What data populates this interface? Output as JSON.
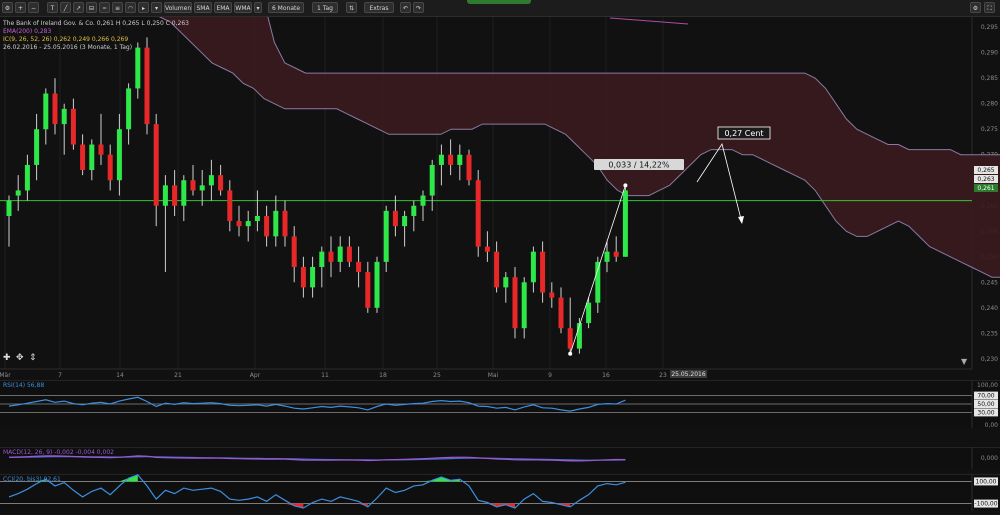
{
  "toolbar": {
    "buttons": [
      {
        "label": "Volumen",
        "name": "volume-button"
      },
      {
        "label": "SMA",
        "name": "sma-button"
      },
      {
        "label": "EMA",
        "name": "ema-button"
      },
      {
        "label": "WMA",
        "name": "wma-button"
      },
      {
        "label": "6 Monate",
        "name": "period-select"
      },
      {
        "label": "1 Tag",
        "name": "interval-select"
      },
      {
        "label": "Extras",
        "name": "extras-button"
      }
    ]
  },
  "legend": {
    "line1": "The Bank of Ireland Gov. & Co.  0,261  H  0,265  L  0,250  C  0,263",
    "line2": "EMA(200)  0,283",
    "line3": "IC(9, 26, 52, 26)  0,262  0,249  0,266  0,269",
    "line4": "26.02.2016 - 25.05.2016 (3 Monate, 1 Tag)"
  },
  "annotations": {
    "measure": "0,033 / 14,22%",
    "cent": "0,27 Cent",
    "date_badge": "25.05.2016"
  },
  "price_tags": {
    "a": "0,265",
    "b": "0,263",
    "c": "0,261"
  },
  "indicators": {
    "rsi": {
      "label": "RSI(14)  56,88",
      "color": "#3d8fe0",
      "levels": [
        "70,00",
        "50,00",
        "30,00"
      ],
      "axis": "100,00",
      "zero": "0,00"
    },
    "macd": {
      "label": "MACD(12, 26, 9)  -0,002  -0,004  0,002",
      "color": "#9b59d0",
      "axis": "0,000"
    },
    "cci": {
      "label": "CCI(20, bis3)  92,61",
      "color": "#3d8fe0",
      "levels": [
        "100,00",
        "-100,00"
      ]
    }
  },
  "colors": {
    "up": "#2ee84a",
    "down": "#e82828",
    "cloud": "#3a1a1d",
    "cloud_line": "#8a7aa4",
    "price_line": "#36c236",
    "background": "#111111"
  },
  "chart_data": [
    {
      "type": "candlestick",
      "title": "The Bank of Ireland Gov. & Co.",
      "x_tick_labels": [
        "Mär",
        "7",
        "14",
        "21",
        "Apr",
        "11",
        "18",
        "25",
        "Mai",
        "9",
        "16",
        "23"
      ],
      "y_tick_labels": [
        "0,230",
        "0,235",
        "0,240",
        "0,245",
        "0,250",
        "0,255",
        "0,260",
        "0,265",
        "0,270",
        "0,275",
        "0,280",
        "0,285",
        "0,290",
        "0,295"
      ],
      "ylim": [
        0.228,
        0.297
      ],
      "current_price": 0.261,
      "candles": [
        {
          "o": 0.258,
          "h": 0.262,
          "l": 0.252,
          "c": 0.261
        },
        {
          "o": 0.262,
          "h": 0.266,
          "l": 0.259,
          "c": 0.263
        },
        {
          "o": 0.263,
          "h": 0.27,
          "l": 0.261,
          "c": 0.268
        },
        {
          "o": 0.268,
          "h": 0.278,
          "l": 0.265,
          "c": 0.275
        },
        {
          "o": 0.275,
          "h": 0.283,
          "l": 0.272,
          "c": 0.282
        },
        {
          "o": 0.282,
          "h": 0.285,
          "l": 0.274,
          "c": 0.276
        },
        {
          "o": 0.276,
          "h": 0.28,
          "l": 0.27,
          "c": 0.279
        },
        {
          "o": 0.279,
          "h": 0.281,
          "l": 0.271,
          "c": 0.272
        },
        {
          "o": 0.272,
          "h": 0.274,
          "l": 0.266,
          "c": 0.267
        },
        {
          "o": 0.267,
          "h": 0.273,
          "l": 0.265,
          "c": 0.272
        },
        {
          "o": 0.272,
          "h": 0.278,
          "l": 0.268,
          "c": 0.27
        },
        {
          "o": 0.27,
          "h": 0.272,
          "l": 0.263,
          "c": 0.265
        },
        {
          "o": 0.265,
          "h": 0.278,
          "l": 0.262,
          "c": 0.275
        },
        {
          "o": 0.275,
          "h": 0.284,
          "l": 0.272,
          "c": 0.283
        },
        {
          "o": 0.283,
          "h": 0.292,
          "l": 0.281,
          "c": 0.291
        },
        {
          "o": 0.291,
          "h": 0.293,
          "l": 0.274,
          "c": 0.276
        },
        {
          "o": 0.276,
          "h": 0.278,
          "l": 0.256,
          "c": 0.26
        },
        {
          "o": 0.26,
          "h": 0.266,
          "l": 0.247,
          "c": 0.264
        },
        {
          "o": 0.264,
          "h": 0.267,
          "l": 0.258,
          "c": 0.26
        },
        {
          "o": 0.26,
          "h": 0.266,
          "l": 0.257,
          "c": 0.265
        },
        {
          "o": 0.265,
          "h": 0.268,
          "l": 0.262,
          "c": 0.263
        },
        {
          "o": 0.263,
          "h": 0.267,
          "l": 0.26,
          "c": 0.264
        },
        {
          "o": 0.264,
          "h": 0.269,
          "l": 0.261,
          "c": 0.266
        },
        {
          "o": 0.266,
          "h": 0.268,
          "l": 0.262,
          "c": 0.263
        },
        {
          "o": 0.263,
          "h": 0.265,
          "l": 0.255,
          "c": 0.257
        },
        {
          "o": 0.257,
          "h": 0.26,
          "l": 0.254,
          "c": 0.256
        },
        {
          "o": 0.256,
          "h": 0.259,
          "l": 0.253,
          "c": 0.257
        },
        {
          "o": 0.257,
          "h": 0.263,
          "l": 0.255,
          "c": 0.258
        },
        {
          "o": 0.258,
          "h": 0.26,
          "l": 0.252,
          "c": 0.254
        },
        {
          "o": 0.254,
          "h": 0.262,
          "l": 0.252,
          "c": 0.259
        },
        {
          "o": 0.259,
          "h": 0.261,
          "l": 0.252,
          "c": 0.254
        },
        {
          "o": 0.254,
          "h": 0.256,
          "l": 0.245,
          "c": 0.248
        },
        {
          "o": 0.248,
          "h": 0.25,
          "l": 0.242,
          "c": 0.244
        },
        {
          "o": 0.244,
          "h": 0.25,
          "l": 0.242,
          "c": 0.248
        },
        {
          "o": 0.248,
          "h": 0.252,
          "l": 0.244,
          "c": 0.251
        },
        {
          "o": 0.251,
          "h": 0.254,
          "l": 0.246,
          "c": 0.249
        },
        {
          "o": 0.249,
          "h": 0.254,
          "l": 0.247,
          "c": 0.252
        },
        {
          "o": 0.252,
          "h": 0.254,
          "l": 0.248,
          "c": 0.249
        },
        {
          "o": 0.249,
          "h": 0.252,
          "l": 0.244,
          "c": 0.247
        },
        {
          "o": 0.247,
          "h": 0.249,
          "l": 0.239,
          "c": 0.24
        },
        {
          "o": 0.24,
          "h": 0.25,
          "l": 0.239,
          "c": 0.249
        },
        {
          "o": 0.249,
          "h": 0.26,
          "l": 0.247,
          "c": 0.259
        },
        {
          "o": 0.259,
          "h": 0.262,
          "l": 0.254,
          "c": 0.256
        },
        {
          "o": 0.256,
          "h": 0.259,
          "l": 0.252,
          "c": 0.258
        },
        {
          "o": 0.258,
          "h": 0.261,
          "l": 0.255,
          "c": 0.26
        },
        {
          "o": 0.26,
          "h": 0.263,
          "l": 0.257,
          "c": 0.262
        },
        {
          "o": 0.262,
          "h": 0.269,
          "l": 0.259,
          "c": 0.268
        },
        {
          "o": 0.268,
          "h": 0.272,
          "l": 0.264,
          "c": 0.27
        },
        {
          "o": 0.27,
          "h": 0.273,
          "l": 0.266,
          "c": 0.268
        },
        {
          "o": 0.268,
          "h": 0.272,
          "l": 0.265,
          "c": 0.27
        },
        {
          "o": 0.27,
          "h": 0.271,
          "l": 0.264,
          "c": 0.265
        },
        {
          "o": 0.265,
          "h": 0.267,
          "l": 0.25,
          "c": 0.252
        },
        {
          "o": 0.252,
          "h": 0.255,
          "l": 0.249,
          "c": 0.251
        },
        {
          "o": 0.251,
          "h": 0.253,
          "l": 0.243,
          "c": 0.244
        },
        {
          "o": 0.244,
          "h": 0.247,
          "l": 0.241,
          "c": 0.246
        },
        {
          "o": 0.246,
          "h": 0.248,
          "l": 0.234,
          "c": 0.236
        },
        {
          "o": 0.236,
          "h": 0.246,
          "l": 0.234,
          "c": 0.245
        },
        {
          "o": 0.245,
          "h": 0.252,
          "l": 0.243,
          "c": 0.251
        },
        {
          "o": 0.251,
          "h": 0.253,
          "l": 0.241,
          "c": 0.243
        },
        {
          "o": 0.243,
          "h": 0.245,
          "l": 0.24,
          "c": 0.242
        },
        {
          "o": 0.242,
          "h": 0.244,
          "l": 0.235,
          "c": 0.236
        },
        {
          "o": 0.236,
          "h": 0.242,
          "l": 0.231,
          "c": 0.232
        },
        {
          "o": 0.232,
          "h": 0.238,
          "l": 0.231,
          "c": 0.237
        },
        {
          "o": 0.237,
          "h": 0.242,
          "l": 0.236,
          "c": 0.241
        },
        {
          "o": 0.241,
          "h": 0.25,
          "l": 0.239,
          "c": 0.249
        },
        {
          "o": 0.249,
          "h": 0.253,
          "l": 0.247,
          "c": 0.251
        },
        {
          "o": 0.251,
          "h": 0.254,
          "l": 0.249,
          "c": 0.25
        },
        {
          "o": 0.25,
          "h": 0.264,
          "l": 0.25,
          "c": 0.263
        }
      ],
      "cloud_upper": [
        0.3,
        0.3,
        0.3,
        0.3,
        0.3,
        0.3,
        0.3,
        0.3,
        0.3,
        0.3,
        0.3,
        0.3,
        0.3,
        0.3,
        0.3,
        0.3,
        0.292,
        0.288,
        0.287,
        0.286,
        0.286,
        0.286,
        0.286,
        0.286,
        0.286,
        0.286,
        0.286,
        0.286,
        0.286,
        0.286,
        0.286,
        0.286,
        0.286,
        0.286,
        0.286,
        0.286,
        0.286,
        0.286,
        0.286,
        0.286,
        0.286,
        0.286,
        0.286,
        0.286,
        0.286,
        0.286,
        0.286,
        0.286,
        0.286,
        0.286,
        0.286,
        0.286,
        0.286,
        0.286,
        0.286,
        0.286,
        0.286,
        0.286,
        0.286,
        0.286,
        0.286,
        0.286,
        0.286,
        0.286,
        0.286,
        0.286,
        0.286,
        0.286,
        0.285,
        0.283,
        0.28,
        0.277,
        0.275,
        0.274,
        0.273,
        0.272,
        0.272,
        0.271,
        0.271,
        0.271,
        0.271,
        0.271,
        0.27,
        0.27,
        0.27,
        0.27,
        0.27,
        0.27,
        0.27,
        0.27,
        0.27,
        0.27,
        0.27
      ],
      "cloud_lower": [
        0.3,
        0.3,
        0.3,
        0.299,
        0.298,
        0.297,
        0.296,
        0.294,
        0.292,
        0.29,
        0.288,
        0.287,
        0.286,
        0.284,
        0.283,
        0.281,
        0.28,
        0.279,
        0.279,
        0.279,
        0.279,
        0.279,
        0.279,
        0.278,
        0.277,
        0.276,
        0.275,
        0.274,
        0.274,
        0.274,
        0.274,
        0.274,
        0.274,
        0.275,
        0.275,
        0.275,
        0.276,
        0.276,
        0.276,
        0.276,
        0.276,
        0.276,
        0.276,
        0.275,
        0.274,
        0.272,
        0.27,
        0.268,
        0.265,
        0.263,
        0.262,
        0.262,
        0.262,
        0.263,
        0.264,
        0.266,
        0.268,
        0.27,
        0.271,
        0.271,
        0.271,
        0.27,
        0.27,
        0.269,
        0.268,
        0.267,
        0.266,
        0.265,
        0.263,
        0.26,
        0.257,
        0.255,
        0.254,
        0.254,
        0.255,
        0.256,
        0.257,
        0.256,
        0.254,
        0.252,
        0.251,
        0.25,
        0.249,
        0.248,
        0.247,
        0.246,
        0.246,
        0.246,
        0.246,
        0.246,
        0.246,
        0.247,
        0.248
      ]
    },
    {
      "type": "line",
      "title": "RSI(14)",
      "ylim": [
        0,
        100
      ],
      "levels": [
        70,
        50,
        30
      ],
      "values": [
        45,
        48,
        52,
        56,
        60,
        54,
        57,
        51,
        48,
        52,
        54,
        50,
        57,
        62,
        66,
        56,
        44,
        52,
        49,
        53,
        51,
        52,
        53,
        51,
        47,
        46,
        47,
        48,
        45,
        49,
        45,
        40,
        38,
        41,
        44,
        42,
        45,
        43,
        41,
        36,
        44,
        50,
        47,
        49,
        51,
        52,
        56,
        58,
        56,
        57,
        53,
        45,
        44,
        40,
        42,
        36,
        43,
        48,
        41,
        40,
        36,
        33,
        38,
        42,
        49,
        51,
        50,
        59
      ]
    },
    {
      "type": "line",
      "title": "MACD(12, 26, 9)",
      "ylim": [
        -0.01,
        0.01
      ],
      "values": [
        0.001,
        0.0012,
        0.0016,
        0.0022,
        0.0028,
        0.0026,
        0.0024,
        0.0019,
        0.0012,
        0.0009,
        0.0008,
        0.0005,
        0.0009,
        0.0018,
        0.0027,
        0.0023,
        0.0008,
        0.0004,
        0.0001,
        0.0,
        -0.0001,
        -0.0001,
        0.0,
        -0.0002,
        -0.0006,
        -0.0009,
        -0.0011,
        -0.0012,
        -0.0014,
        -0.0013,
        -0.0015,
        -0.002,
        -0.0026,
        -0.0028,
        -0.0027,
        -0.0027,
        -0.0025,
        -0.0025,
        -0.0026,
        -0.0031,
        -0.0029,
        -0.0022,
        -0.002,
        -0.0017,
        -0.0013,
        -0.0009,
        -0.0002,
        0.0004,
        0.0007,
        0.001,
        0.0009,
        0.0001,
        -0.0005,
        -0.0012,
        -0.0016,
        -0.0023,
        -0.0024,
        -0.0022,
        -0.0025,
        -0.0027,
        -0.0031,
        -0.0036,
        -0.0036,
        -0.0034,
        -0.0028,
        -0.0022,
        -0.0019,
        -0.002
      ],
      "signal": [
        0.0008,
        0.0009,
        0.001,
        0.0012,
        0.0015,
        0.0017,
        0.0018,
        0.0018,
        0.0017,
        0.0015,
        0.0014,
        0.0012,
        0.0011,
        0.0012,
        0.0015,
        0.0016,
        0.0015,
        0.0013,
        0.001,
        0.0008,
        0.0006,
        0.0004,
        0.0003,
        0.0002,
        0.0,
        -0.0002,
        -0.0004,
        -0.0005,
        -0.0007,
        -0.0008,
        -0.0009,
        -0.0011,
        -0.0014,
        -0.0017,
        -0.0019,
        -0.002,
        -0.0021,
        -0.0022,
        -0.0023,
        -0.0024,
        -0.0025,
        -0.0024,
        -0.0023,
        -0.0022,
        -0.002,
        -0.0018,
        -0.0015,
        -0.0011,
        -0.0008,
        -0.0004,
        -0.0002,
        -0.0002,
        -0.0003,
        -0.0005,
        -0.0007,
        -0.001,
        -0.0013,
        -0.0015,
        -0.0017,
        -0.0019,
        -0.0021,
        -0.0024,
        -0.0026,
        -0.0027,
        -0.0027,
        -0.0026,
        -0.0025,
        -0.0024
      ]
    },
    {
      "type": "line",
      "title": "CCI(20, bis3)",
      "ylim": [
        -140,
        140
      ],
      "levels": [
        100,
        -100
      ],
      "values": [
        -40,
        -10,
        30,
        80,
        120,
        60,
        90,
        20,
        -40,
        10,
        40,
        -20,
        60,
        130,
        160,
        60,
        -60,
        20,
        -10,
        40,
        20,
        30,
        40,
        10,
        -60,
        -70,
        -60,
        -40,
        -80,
        -20,
        -70,
        -120,
        -140,
        -90,
        -60,
        -80,
        -40,
        -60,
        -80,
        -130,
        -50,
        40,
        0,
        20,
        60,
        70,
        110,
        140,
        110,
        120,
        60,
        -70,
        -90,
        -130,
        -110,
        -140,
        -60,
        -10,
        -80,
        -90,
        -110,
        -130,
        -70,
        -20,
        60,
        80,
        70,
        92
      ]
    }
  ]
}
